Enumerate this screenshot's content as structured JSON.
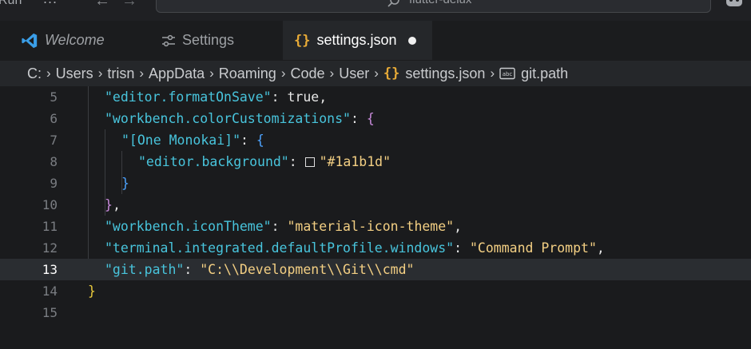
{
  "titlebar": {
    "run_label": "Run",
    "dots": "...",
    "command_center_text": "flutter-delux"
  },
  "tabs": [
    {
      "label": "Welcome",
      "icon": "vscode-logo-icon"
    },
    {
      "label": "Settings",
      "icon": "settings-sliders-icon"
    },
    {
      "label": "settings.json",
      "icon": "json-braces-icon",
      "dirty": true,
      "active": true
    }
  ],
  "breadcrumb": [
    "C:",
    "Users",
    "trisn",
    "AppData",
    "Roaming",
    "Code",
    "User",
    "settings.json",
    "git.path"
  ],
  "editor": {
    "current_line": 13,
    "line_numbers": [
      "5",
      "6",
      "7",
      "8",
      "9",
      "10",
      "11",
      "12",
      "13",
      "14",
      "15"
    ],
    "lines": {
      "l5": {
        "key": "\"editor.formatOnSave\"",
        "sep": ": ",
        "value": "true",
        "tail": ","
      },
      "l6": {
        "key": "\"workbench.colorCustomizations\"",
        "sep": ": ",
        "brace": "{"
      },
      "l7": {
        "key": "\"[One Monokai]\"",
        "sep": ": ",
        "brace": "{"
      },
      "l8": {
        "key": "\"editor.background\"",
        "sep": ": ",
        "value": "\"#1a1b1d\""
      },
      "l9": {
        "brace": "}"
      },
      "l10": {
        "brace": "}",
        "tail": ","
      },
      "l11": {
        "key": "\"workbench.iconTheme\"",
        "sep": ": ",
        "value": "\"material-icon-theme\"",
        "tail": ","
      },
      "l12": {
        "key": "\"terminal.integrated.defaultProfile.windows\"",
        "sep": ": ",
        "value": "\"Command Prompt\"",
        "tail": ","
      },
      "l13": {
        "key": "\"git.path\"",
        "sep": ": ",
        "value": "\"C:\\\\Development\\\\Git\\\\cmd\""
      },
      "l14": {
        "brace": "}"
      }
    },
    "swatch_color": "#1a1b1d"
  },
  "colors": {
    "accent_braces": "#e8ab37",
    "key": "#48c4dc",
    "string": "#f3cf83",
    "editor_bg": "#1a1b1d"
  }
}
